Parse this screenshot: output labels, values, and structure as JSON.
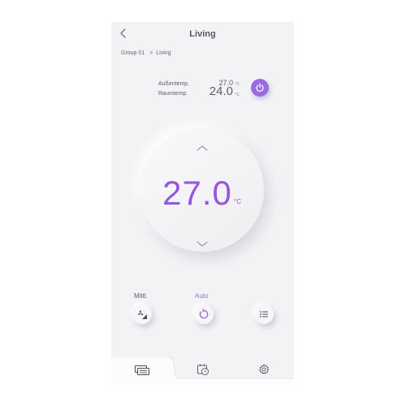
{
  "header": {
    "title": "Living",
    "back_icon": "chevron-left-icon"
  },
  "breadcrumb": {
    "group": "Group 01",
    "separator": ">",
    "room": "Living"
  },
  "temperatures": {
    "outside_label": "Außentemp.",
    "outside_value": "27.0",
    "outside_unit": "°C",
    "room_label": "Raumtemp.",
    "room_value": "24.0",
    "room_unit": "°C"
  },
  "power": {
    "icon": "power-icon",
    "state_on": true
  },
  "dial": {
    "set_temperature": "27.0",
    "unit": "°C",
    "up_icon": "chevron-up-icon",
    "down_icon": "chevron-down-icon"
  },
  "modes": {
    "fan_label": "Mittl.",
    "fan_icon": "fan-speed-icon",
    "auto_label": "Auto",
    "auto_icon": "auto-mode-icon",
    "more_icon": "list-menu-icon"
  },
  "tabs": [
    {
      "name": "devices",
      "icon": "devices-icon",
      "active": true
    },
    {
      "name": "timer",
      "icon": "timer-icon",
      "active": false
    },
    {
      "name": "settings",
      "icon": "gear-icon",
      "active": false
    }
  ],
  "colors": {
    "accent": "#9457dd",
    "power_button": "#9a6be0",
    "background": "#f3f3f5",
    "text": "#5a5f66"
  }
}
